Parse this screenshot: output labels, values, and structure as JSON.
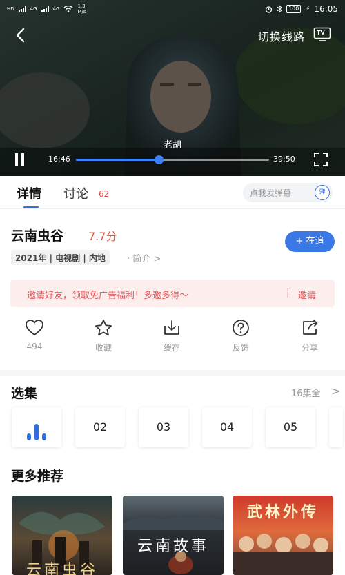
{
  "status_bar": {
    "sim1": "HD",
    "sim2": "HD",
    "net1": "4G",
    "net2": "4G",
    "speed_value": "1.3",
    "speed_unit": "M/s",
    "battery": "100",
    "time": "16:05"
  },
  "player": {
    "switch_route_label": "切换线路",
    "tv_label": "TV",
    "subtitle": "老胡",
    "current_time": "16:46",
    "total_time": "39:50",
    "progress": 0.43
  },
  "tabs": {
    "detail": "详情",
    "discuss": "讨论",
    "discuss_count": "62",
    "danmu_placeholder": "点我发弹幕",
    "danmu_icon_label": "弹"
  },
  "info": {
    "title": "云南虫谷",
    "score": "7.7分",
    "meta": "2021年 | 电视剧 | 内地",
    "intro_label": "· 简介 >",
    "follow_label": "+ 在追"
  },
  "invite": {
    "text": "邀请好友，领取免广告福利！多邀多得～",
    "separator": "|",
    "button": "邀请"
  },
  "actions": [
    {
      "label": "494",
      "icon": "heart-icon"
    },
    {
      "label": "收藏",
      "icon": "star-icon"
    },
    {
      "label": "缓存",
      "icon": "download-icon"
    },
    {
      "label": "反馈",
      "icon": "question-icon"
    },
    {
      "label": "分享",
      "icon": "share-icon"
    }
  ],
  "episodes": {
    "title": "选集",
    "all_label": "16集全",
    "arrow": ">",
    "items": [
      "02",
      "03",
      "04",
      "05"
    ]
  },
  "recommend": {
    "title": "更多推荐",
    "items": [
      {
        "caption": "云南虫谷"
      },
      {
        "caption": "云南故事"
      },
      {
        "caption": "武林外传"
      }
    ]
  },
  "colors": {
    "accent": "#3a78e6",
    "score": "#e8553e",
    "invite_bg": "#fdeeee",
    "invite_text": "#e35a5a"
  }
}
